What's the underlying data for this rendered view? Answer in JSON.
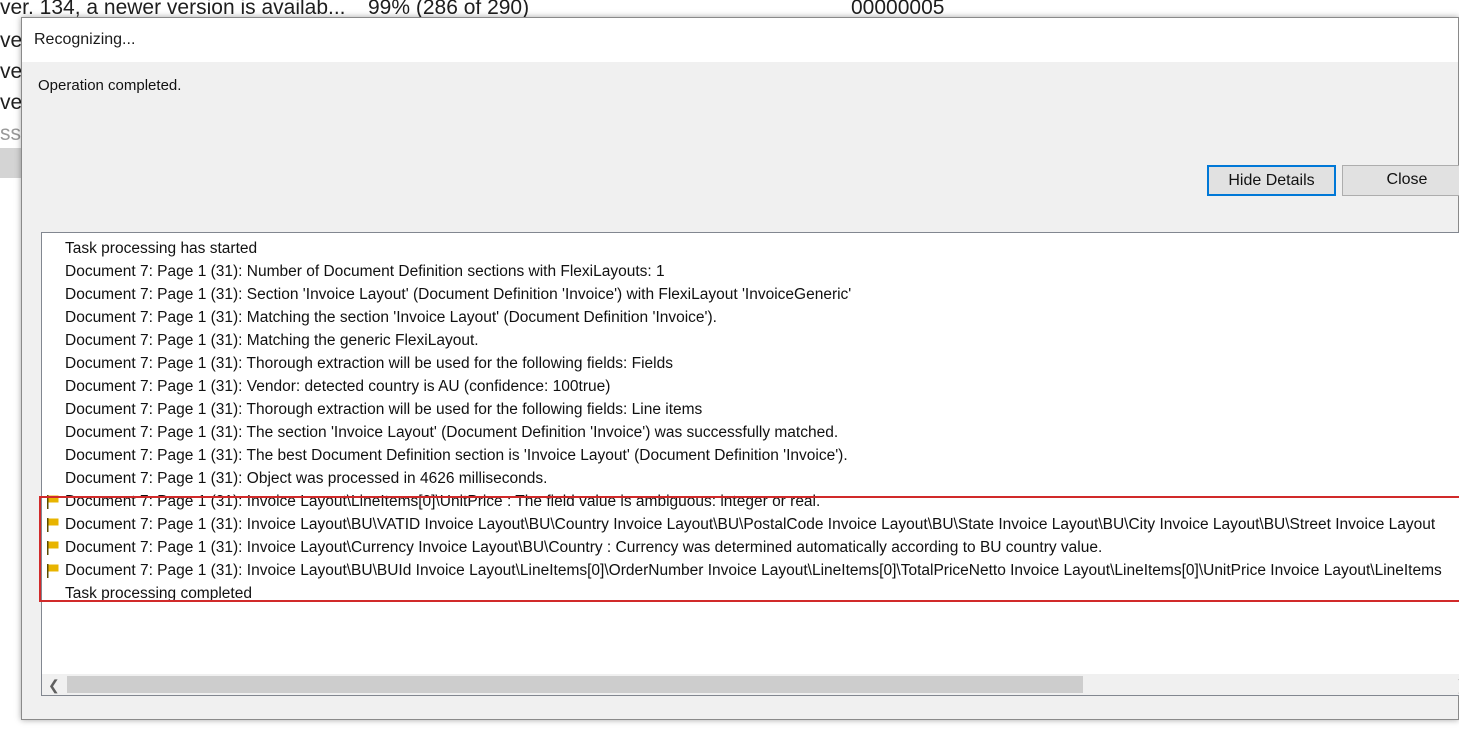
{
  "background": {
    "rows": [
      "ver. 134, a newer version is availab...",
      "ve",
      "ve",
      "ve",
      "sse"
    ],
    "progress_text": "99% (286 of 290)",
    "counter_text": "00000005"
  },
  "dialog": {
    "title": "Recognizing...",
    "status": "Operation completed.",
    "buttons": {
      "hide_details": "Hide Details",
      "close": "Close"
    },
    "log": [
      {
        "text": "Task processing has started",
        "flag": false
      },
      {
        "text": "Document 7: Page 1 (31): Number of Document Definition sections with FlexiLayouts: 1",
        "flag": false
      },
      {
        "text": "Document 7: Page 1 (31): Section 'Invoice Layout' (Document Definition 'Invoice') with FlexiLayout 'InvoiceGeneric'",
        "flag": false
      },
      {
        "text": "Document 7: Page 1 (31): Matching the section 'Invoice Layout' (Document Definition 'Invoice').",
        "flag": false
      },
      {
        "text": "Document 7: Page 1 (31): Matching the generic FlexiLayout.",
        "flag": false
      },
      {
        "text": "Document 7: Page 1 (31): Thorough extraction will be used for the following fields: Fields",
        "flag": false
      },
      {
        "text": "Document 7: Page 1 (31): Vendor: detected country is AU (confidence: 100true)",
        "flag": false
      },
      {
        "text": "Document 7: Page 1 (31): Thorough extraction will be used for the following fields: Line items",
        "flag": false
      },
      {
        "text": "Document 7: Page 1 (31): The section 'Invoice Layout' (Document Definition 'Invoice') was successfully matched.",
        "flag": false
      },
      {
        "text": "Document 7: Page 1 (31): The best Document Definition section is 'Invoice Layout' (Document Definition 'Invoice').",
        "flag": false
      },
      {
        "text": "Document 7: Page 1 (31): Object was processed in 4626 milliseconds.",
        "flag": false
      },
      {
        "text": "Document 7: Page 1 (31): Invoice Layout\\LineItems[0]\\UnitPrice  : The field value is ambiguous: integer or real.",
        "flag": true
      },
      {
        "text": "Document 7: Page 1 (31): Invoice Layout\\BU\\VATID Invoice Layout\\BU\\Country Invoice Layout\\BU\\PostalCode Invoice Layout\\BU\\State Invoice Layout\\BU\\City Invoice Layout\\BU\\Street Invoice Layout",
        "flag": true
      },
      {
        "text": "Document 7: Page 1 (31): Invoice Layout\\Currency Invoice Layout\\BU\\Country  : Currency was determined automatically according to BU country value.",
        "flag": true
      },
      {
        "text": "Document 7: Page 1 (31): Invoice Layout\\BU\\BUId Invoice Layout\\LineItems[0]\\OrderNumber Invoice Layout\\LineItems[0]\\TotalPriceNetto Invoice Layout\\LineItems[0]\\UnitPrice Invoice Layout\\LineItems",
        "flag": true
      },
      {
        "text": "Task processing completed",
        "flag": false
      }
    ]
  },
  "colors": {
    "highlight": "#d12a2a",
    "flag": "#e8b400",
    "button_focus": "#0078d7"
  }
}
